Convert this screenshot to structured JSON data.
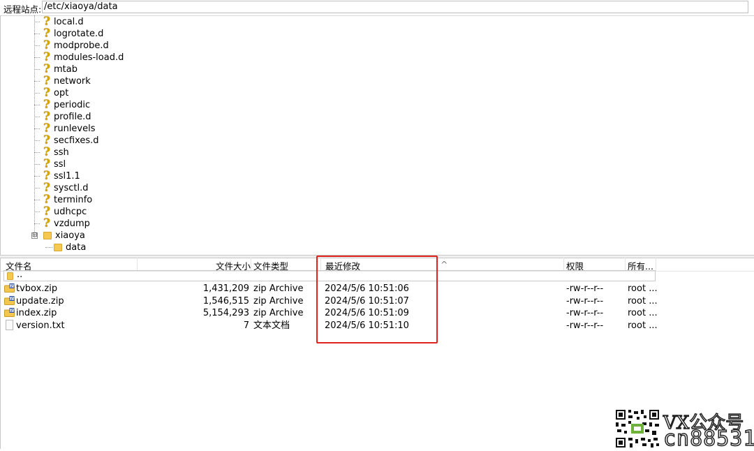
{
  "remote_site": {
    "label": "远程站点:",
    "path": "/etc/xiaoya/data"
  },
  "tree": {
    "items": [
      {
        "label": "local.d"
      },
      {
        "label": "logrotate.d"
      },
      {
        "label": "modprobe.d"
      },
      {
        "label": "modules-load.d"
      },
      {
        "label": "mtab"
      },
      {
        "label": "network"
      },
      {
        "label": "opt"
      },
      {
        "label": "periodic"
      },
      {
        "label": "profile.d"
      },
      {
        "label": "runlevels"
      },
      {
        "label": "secfixes.d"
      },
      {
        "label": "ssh"
      },
      {
        "label": "ssl"
      },
      {
        "label": "ssl1.1"
      },
      {
        "label": "sysctl.d"
      },
      {
        "label": "terminfo"
      },
      {
        "label": "udhcpc"
      },
      {
        "label": "vzdump"
      }
    ],
    "expanded": {
      "label": "xiaoya",
      "expander": "⊟",
      "child": "data"
    }
  },
  "file_list": {
    "columns": {
      "name": "文件名",
      "size": "文件大小",
      "type": "文件类型",
      "modified": "最近修改",
      "perms": "权限",
      "owner": "所有..."
    },
    "parent": "..",
    "rows": [
      {
        "name": "tvbox.zip",
        "size": "1,431,209",
        "type": "zip Archive",
        "modified": "2024/5/6 10:51:06",
        "perms": "-rw-r--r--",
        "owner": "root ...",
        "icon": "zip-icon"
      },
      {
        "name": "update.zip",
        "size": "1,546,515",
        "type": "zip Archive",
        "modified": "2024/5/6 10:51:07",
        "perms": "-rw-r--r--",
        "owner": "root ...",
        "icon": "zip-icon"
      },
      {
        "name": "index.zip",
        "size": "5,154,293",
        "type": "zip Archive",
        "modified": "2024/5/6 10:51:09",
        "perms": "-rw-r--r--",
        "owner": "root ...",
        "icon": "zip-icon"
      },
      {
        "name": "version.txt",
        "size": "7",
        "type": "文本文档",
        "modified": "2024/5/6 10:51:10",
        "perms": "-rw-r--r--",
        "owner": "root ...",
        "icon": "text-file-icon"
      }
    ]
  },
  "highlight_color": "#e0231c",
  "watermark": {
    "line1": "VX公众号",
    "line2": "cn88531"
  }
}
